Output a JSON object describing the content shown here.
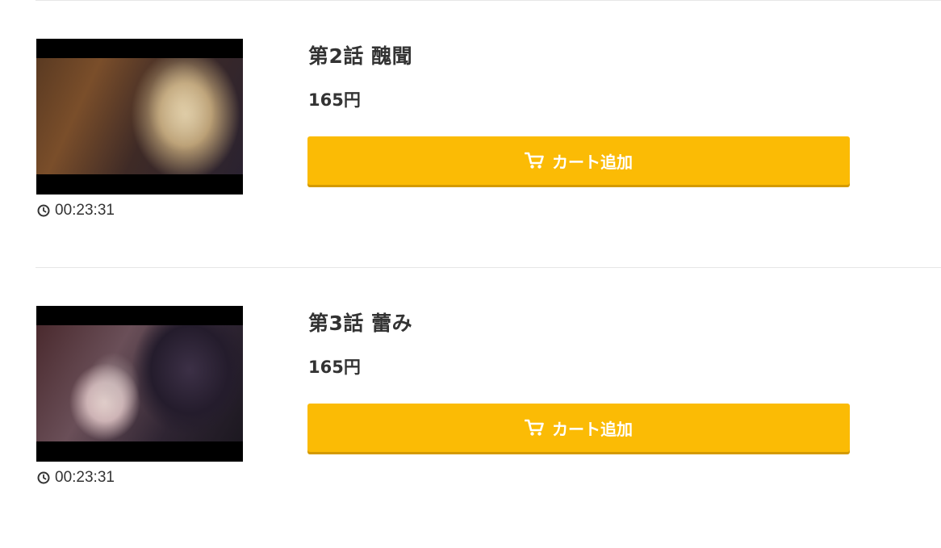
{
  "episodes": [
    {
      "title": "第2話 醜聞",
      "price": "165円",
      "duration": "00:23:31",
      "cart_label": "カート追加",
      "thumbnail_alt": "thumbnail"
    },
    {
      "title": "第3話 蕾み",
      "price": "165円",
      "duration": "00:23:31",
      "cart_label": "カート追加",
      "thumbnail_alt": "thumbnail"
    }
  ],
  "colors": {
    "cart_button": "#fbbb05",
    "cart_button_shadow": "#d49a00",
    "text": "#333333",
    "divider": "#e6e6e6"
  },
  "icons": {
    "duration": "clock-icon",
    "cart": "cart-icon"
  }
}
